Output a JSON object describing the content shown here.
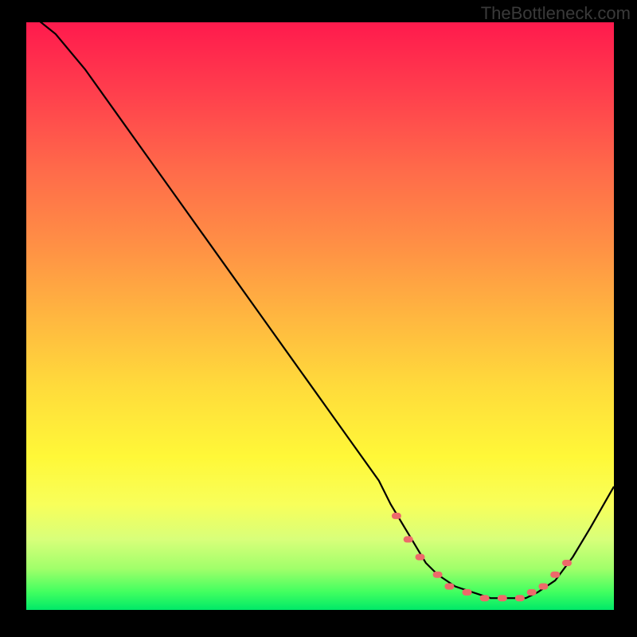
{
  "attribution": "TheBottleneck.com",
  "chart_data": {
    "type": "line",
    "title": "",
    "xlabel": "",
    "ylabel": "",
    "xlim": [
      0,
      100
    ],
    "ylim": [
      0,
      100
    ],
    "series": [
      {
        "name": "curve",
        "x": [
          0,
          5,
          10,
          15,
          20,
          25,
          30,
          35,
          40,
          45,
          50,
          55,
          60,
          62,
          65,
          68,
          70,
          73,
          76,
          79,
          82,
          85,
          87,
          90,
          93,
          96,
          100
        ],
        "y": [
          102,
          98,
          92,
          85,
          78,
          71,
          64,
          57,
          50,
          43,
          36,
          29,
          22,
          18,
          13,
          8,
          6,
          4,
          3,
          2,
          2,
          2,
          3,
          5,
          9,
          14,
          21
        ],
        "color": "#000000"
      },
      {
        "name": "highlight-dots",
        "x": [
          63,
          65,
          67,
          70,
          72,
          75,
          78,
          81,
          84,
          86,
          88,
          90,
          92
        ],
        "y": [
          16,
          12,
          9,
          6,
          4,
          3,
          2,
          2,
          2,
          3,
          4,
          6,
          8
        ],
        "color": "#ed6a6a"
      }
    ],
    "background_gradient": {
      "stops": [
        {
          "pos": 0.0,
          "color": "#ff1a4d"
        },
        {
          "pos": 0.5,
          "color": "#ffb640"
        },
        {
          "pos": 0.82,
          "color": "#f8ff5a"
        },
        {
          "pos": 1.0,
          "color": "#00e868"
        }
      ]
    }
  }
}
